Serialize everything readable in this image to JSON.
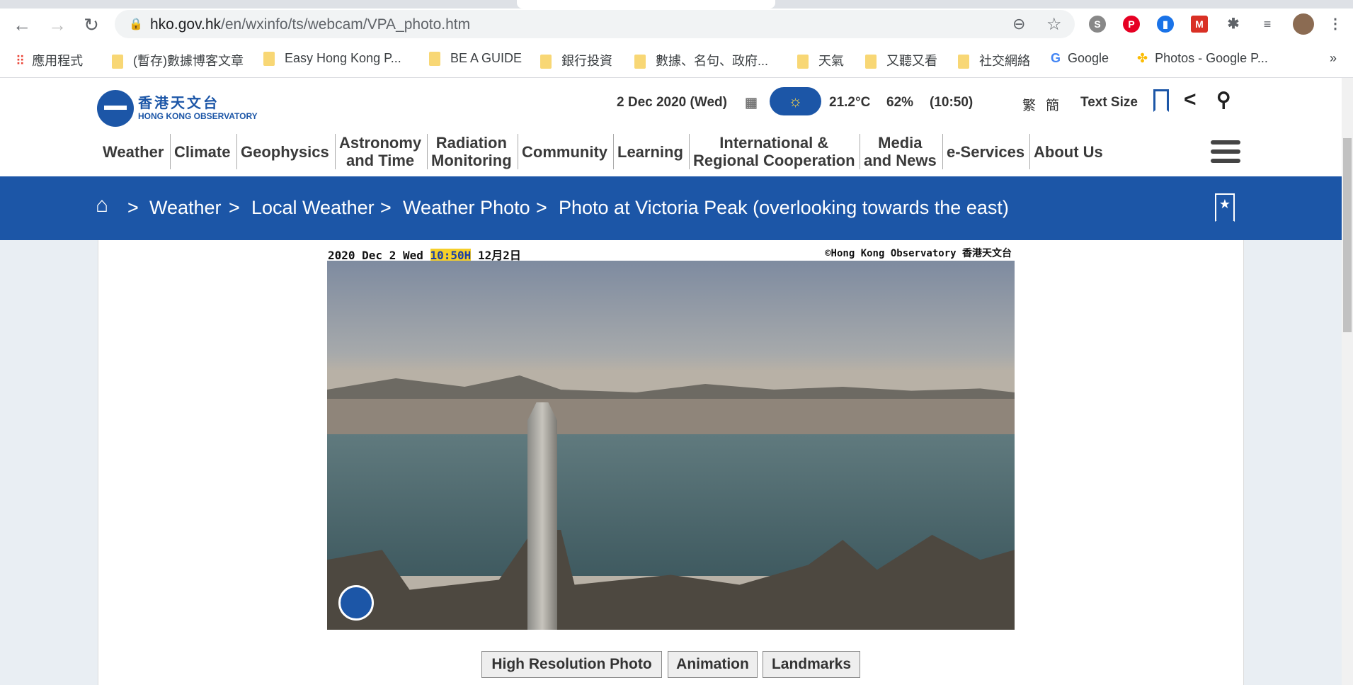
{
  "browser": {
    "url_host": "hko.gov.hk",
    "url_path": "/en/wxinfo/ts/webcam/VPA_photo.htm",
    "bookmarks": [
      "應用程式",
      "(暫存)數據博客文章",
      "Easy Hong Kong P...",
      "BE A GUIDE",
      "銀行投資",
      "數據、名句、政府...",
      "天氣",
      "又聽又看",
      "社交網絡",
      "Google",
      "Photos - Google P..."
    ],
    "more": "»"
  },
  "header": {
    "logo_zh": "香港天文台",
    "logo_en": "HONG KONG OBSERVATORY",
    "date": "2 Dec 2020 (Wed)",
    "temperature": "21.2°C",
    "humidity": "62%",
    "time": "(10:50)",
    "lang_trad": "繁",
    "lang_simp": "簡",
    "text_size": "Text Size",
    "weather_icon": "sunny-icon",
    "accent": "#1c56a7"
  },
  "nav": [
    {
      "l1": "Weather"
    },
    {
      "l1": "Climate"
    },
    {
      "l1": "Geophysics"
    },
    {
      "l1": "Astronomy",
      "l2": "and Time"
    },
    {
      "l1": "Radiation",
      "l2": "Monitoring"
    },
    {
      "l1": "Community"
    },
    {
      "l1": "Learning"
    },
    {
      "l1": "International &",
      "l2": "Regional Cooperation"
    },
    {
      "l1": "Media",
      "l2": "and News"
    },
    {
      "l1": "e-Services"
    },
    {
      "l1": "About Us"
    }
  ],
  "breadcrumb": {
    "items": [
      "Weather",
      "Local Weather",
      "Weather Photo",
      "Photo at Victoria Peak (overlooking towards the east)"
    ],
    "sep": ">"
  },
  "photo": {
    "date": "2020 Dec 2 Wed",
    "time": "10:50H",
    "date_zh": "12月2日",
    "copyright": "©Hong Kong Observatory 香港天文台"
  },
  "buttons": {
    "high_res": "High Resolution Photo",
    "animation": "Animation",
    "landmarks": "Landmarks"
  }
}
